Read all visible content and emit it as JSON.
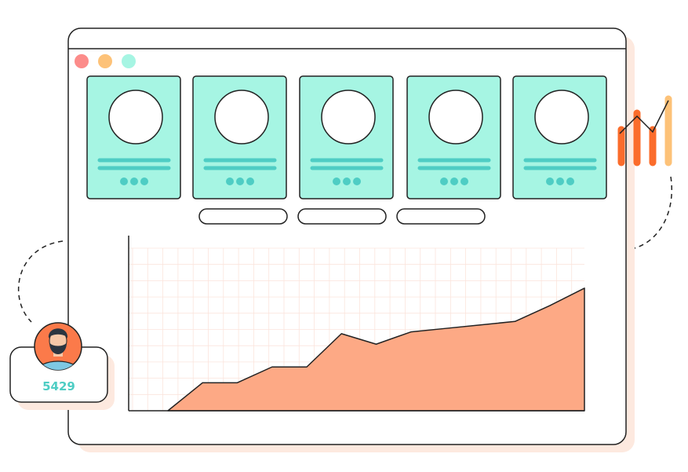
{
  "window": {
    "controls": [
      "close",
      "minimize",
      "maximize"
    ],
    "colors": {
      "close": "#fc8c8a",
      "minimize": "#fdc278",
      "maximize": "#a6f5e3"
    }
  },
  "profile_cards": [
    {
      "icon": "avatar-placeholder-icon"
    },
    {
      "icon": "avatar-placeholder-icon"
    },
    {
      "icon": "avatar-placeholder-icon"
    },
    {
      "icon": "avatar-placeholder-icon"
    },
    {
      "icon": "avatar-placeholder-icon"
    }
  ],
  "pill_buttons": [
    {},
    {},
    {}
  ],
  "chart_data": {
    "type": "area",
    "x": [
      0,
      1,
      2,
      3,
      4,
      5,
      6,
      7,
      8,
      9,
      10,
      11,
      12
    ],
    "values": [
      0,
      16,
      16,
      25,
      25,
      44,
      38,
      45,
      47,
      49,
      51,
      60,
      70
    ],
    "ylim": [
      0,
      100
    ],
    "grid": true,
    "xlabel": "",
    "ylabel": "",
    "fill_color": "#fda985"
  },
  "user_badge": {
    "count": "5429",
    "avatar_icon": "bearded-man-avatar-icon",
    "count_color": "#4ecdc4"
  },
  "colors": {
    "outline": "#222222",
    "card_fill": "#a6f5e3",
    "card_accent": "#4ecdc4",
    "shadow": "#fde9df",
    "deco_orange": "#fb6c2b",
    "deco_light_orange": "#fdc278"
  }
}
